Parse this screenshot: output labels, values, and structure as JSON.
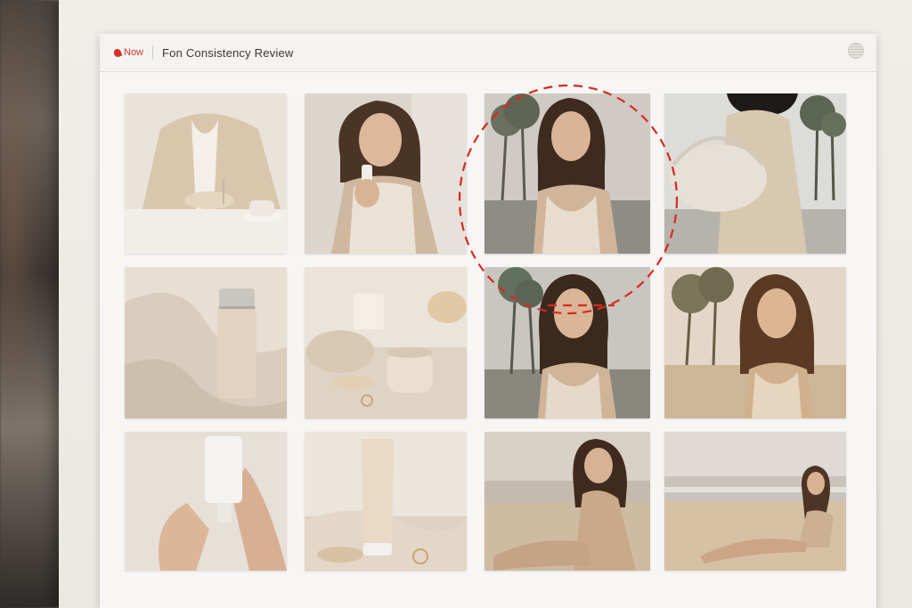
{
  "app": {
    "logo_label": "Now",
    "window_title": "Fon Consistency Review"
  },
  "tiles": [
    {
      "name": "tile-coat-coffee",
      "icon": "photo-icon"
    },
    {
      "name": "tile-woman-serum",
      "icon": "photo-icon"
    },
    {
      "name": "tile-woman-palms",
      "icon": "photo-icon"
    },
    {
      "name": "tile-woman-bag",
      "icon": "photo-icon"
    },
    {
      "name": "tile-bottle-fabric",
      "icon": "photo-icon"
    },
    {
      "name": "tile-jar-still-life",
      "icon": "photo-icon"
    },
    {
      "name": "tile-woman-palms-2",
      "icon": "photo-icon"
    },
    {
      "name": "tile-woman-beach-palms",
      "icon": "photo-icon"
    },
    {
      "name": "tile-hands-tube",
      "icon": "photo-icon"
    },
    {
      "name": "tile-tube-still-life",
      "icon": "photo-icon"
    },
    {
      "name": "tile-woman-sitting-beach",
      "icon": "photo-icon"
    },
    {
      "name": "tile-woman-reclining-beach",
      "icon": "photo-icon"
    }
  ],
  "colors": {
    "accent": "#d2332b",
    "annotation": "#d62a22"
  }
}
